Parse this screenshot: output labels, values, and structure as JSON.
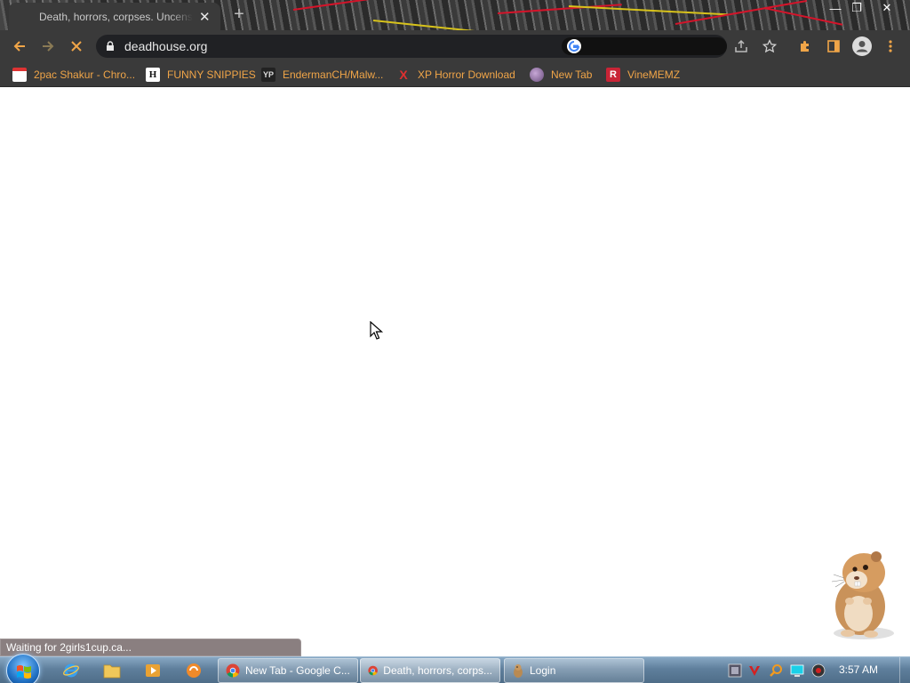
{
  "browser": {
    "tab": {
      "title": "Death, horrors, corpses. Uncensored",
      "close_glyph": "✕"
    },
    "new_tab_glyph": "+",
    "window_controls": {
      "minimize": "—",
      "restore": "❐",
      "close": "✕"
    },
    "toolbar": {
      "back_icon": "arrow-left",
      "forward_icon": "arrow-right",
      "reload_icon": "stop-x",
      "url": "deadhouse.org",
      "accent": "#f0a548"
    },
    "bookmarks": [
      {
        "label": "2pac Shakur - Chro...",
        "icon": "calendar-icon",
        "icon_color": "#d33"
      },
      {
        "label": "FUNNY SNIPPIES",
        "icon_text": "H"
      },
      {
        "label": "EndermanCH/Malw...",
        "icon_text": "YP"
      },
      {
        "label": "XP Horror Download",
        "icon_text": "X"
      },
      {
        "label": "New Tab",
        "icon": "globe-icon"
      },
      {
        "label": "VineMEMZ",
        "icon_text": "R"
      }
    ]
  },
  "status": "Waiting for 2girls1cup.ca...",
  "taskbar": {
    "tasks": [
      {
        "label": "New Tab - Google C...",
        "icon": "chrome-icon"
      },
      {
        "label": "Death, horrors, corps...",
        "icon": "chrome-icon"
      },
      {
        "label": "Login",
        "icon": "gopher-icon"
      }
    ],
    "clock": "3:57 AM"
  }
}
